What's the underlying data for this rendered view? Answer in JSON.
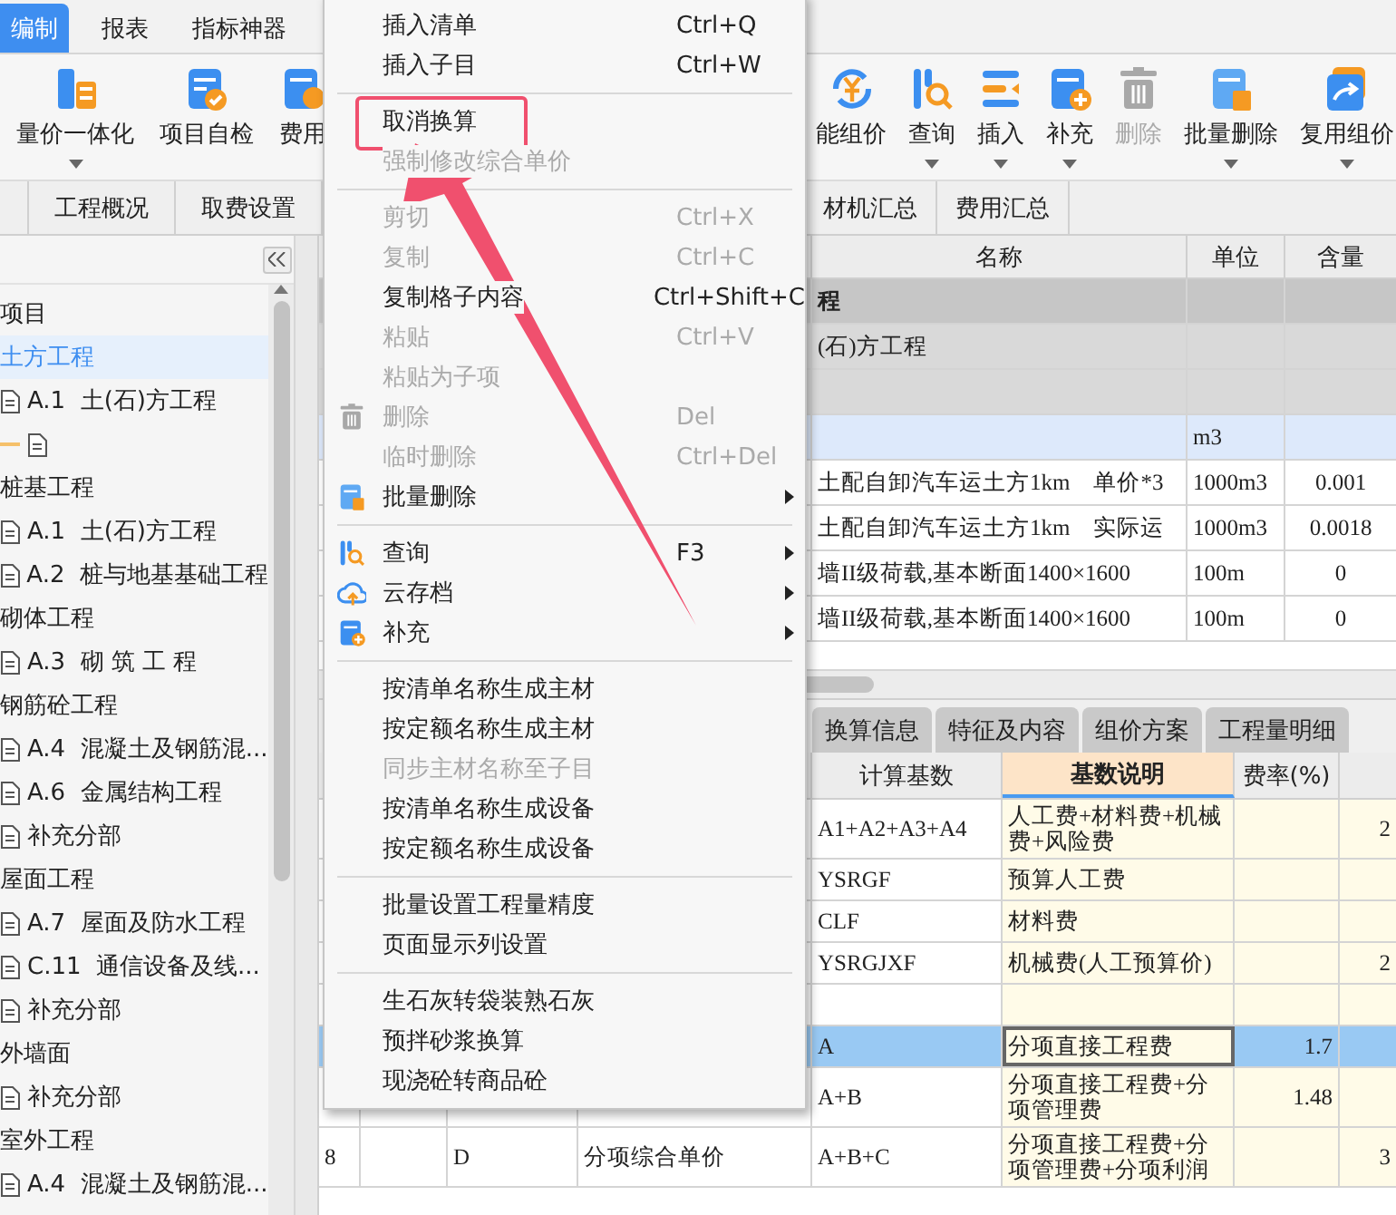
{
  "top_tabs": [
    {
      "label": "编制",
      "selected": true
    },
    {
      "label": "报表",
      "selected": false
    },
    {
      "label": "指标神器",
      "selected": false
    }
  ],
  "toolbar": {
    "left": [
      {
        "label": "量价一体化",
        "dropdown": true,
        "disabled": false
      },
      {
        "label": "项目自检",
        "dropdown": false,
        "disabled": false
      },
      {
        "label": "费用",
        "dropdown": false,
        "disabled": false
      }
    ],
    "right": [
      {
        "label": "能组价",
        "dropdown": false,
        "disabled": false
      },
      {
        "label": "查询",
        "dropdown": true,
        "disabled": false
      },
      {
        "label": "插入",
        "dropdown": true,
        "disabled": false
      },
      {
        "label": "补充",
        "dropdown": true,
        "disabled": false
      },
      {
        "label": "删除",
        "dropdown": false,
        "disabled": true
      },
      {
        "label": "批量删除",
        "dropdown": true,
        "disabled": false
      },
      {
        "label": "复用组价",
        "dropdown": true,
        "disabled": false
      }
    ]
  },
  "sub_tabs": {
    "left": [
      {
        "label": "工程概况",
        "selected": false
      },
      {
        "label": "取费设置",
        "selected": false
      }
    ],
    "right": [
      {
        "label": "材机汇总",
        "selected": false
      },
      {
        "label": "费用汇总",
        "selected": false
      }
    ]
  },
  "tree": [
    {
      "label": "项目",
      "selected": false
    },
    {
      "label": "土方工程",
      "selected": true,
      "children": [
        {
          "label": "A.1  土(石)方工程",
          "selected": false
        },
        {
          "kind": "blank",
          "selected": false
        }
      ]
    },
    {
      "label": "桩基工程",
      "selected": false,
      "children": [
        {
          "label": "A.1  土(石)方工程",
          "selected": false
        },
        {
          "label": "A.2  桩与地基基础工程",
          "selected": false
        }
      ]
    },
    {
      "label": "砌体工程",
      "selected": false,
      "children": [
        {
          "label": "A.3  砌 筑 工 程",
          "selected": false
        }
      ]
    },
    {
      "label": "钢筋砼工程",
      "selected": false,
      "children": [
        {
          "label": "A.4  混凝土及钢筋混...",
          "selected": false
        },
        {
          "label": "A.6  金属结构工程",
          "selected": false
        },
        {
          "label": "补充分部",
          "selected": false
        }
      ]
    },
    {
      "label": "屋面工程",
      "selected": false,
      "children": [
        {
          "label": "A.7  屋面及防水工程",
          "selected": false
        },
        {
          "label": "C.11  通信设备及线...",
          "selected": false
        },
        {
          "label": "补充分部",
          "selected": false
        }
      ]
    },
    {
      "label": "外墙面",
      "selected": false,
      "children": [
        {
          "label": "补充分部",
          "selected": false
        }
      ]
    },
    {
      "label": "室外工程",
      "selected": false,
      "children": [
        {
          "label": "A.4  混凝土及钢筋混...",
          "selected": false
        }
      ]
    }
  ],
  "upper_table": {
    "columns": [
      "名称",
      "单位",
      "含量"
    ],
    "rows": [
      {
        "kind": "section",
        "name": "程",
        "selected": false
      },
      {
        "kind": "subsection",
        "name": "(石)方工程",
        "selected": false
      },
      {
        "kind": "subsection",
        "selected": false
      },
      {
        "kind": "item",
        "unit": "m3",
        "selected": true
      },
      {
        "kind": "item",
        "name": "土配自卸汽车运土方1km　单价*3",
        "unit": "1000m3",
        "amount": "0.001",
        "selected": false
      },
      {
        "kind": "item",
        "name": "土配自卸汽车运土方1km　实际运",
        "unit": "1000m3",
        "amount": "0.0018",
        "selected": false
      },
      {
        "kind": "item",
        "name": "墙II级荷载,基本断面1400×1600",
        "unit": "100m",
        "amount": "0",
        "selected": false
      },
      {
        "kind": "item",
        "name": "墙II级荷载,基本断面1400×1600",
        "unit": "100m",
        "amount": "0",
        "selected": false
      }
    ]
  },
  "lower_tabs": [
    {
      "label": "换算信息",
      "selected": false
    },
    {
      "label": "特征及内容",
      "selected": false
    },
    {
      "label": "组价方案",
      "selected": false
    },
    {
      "label": "工程量明细",
      "selected": false
    }
  ],
  "lower_table": {
    "columns": [
      {
        "label": "计算基数",
        "selected": false
      },
      {
        "label": "基数说明",
        "selected": true
      },
      {
        "label": "费率(%)",
        "selected": false
      }
    ],
    "rows": [
      {
        "base": "A1+A2+A3+A4",
        "desc": "人工费+材料费+机械费+风险费",
        "column_8": "2",
        "selected": false
      },
      {
        "base": "YSRGF",
        "desc": "预算人工费",
        "selected": false
      },
      {
        "base": "CLF",
        "desc": "材料费",
        "selected": false
      },
      {
        "base": "YSRGJXF",
        "desc": "机械费(人工预算价)",
        "column_8": "2",
        "selected": false
      },
      {
        "selected": false
      },
      {
        "base": "A",
        "desc": "分项直接工程费",
        "rate": "1.7",
        "selected": true
      },
      {
        "base": "A+B",
        "desc": "分项直接工程费+分项管理费",
        "rate": "1.48",
        "selected": false
      },
      {
        "index": "8",
        "code": "D",
        "name": "分项综合单价",
        "base": "A+B+C",
        "desc": "分项直接工程费+分项管理费+分项利润",
        "column_8": "3",
        "selected": false
      }
    ]
  },
  "context_menu": [
    {
      "kind": "item",
      "label": "插入清单",
      "shortcut": "Ctrl+Q",
      "disabled": false
    },
    {
      "kind": "item",
      "label": "插入子目",
      "shortcut": "Ctrl+W",
      "disabled": false
    },
    {
      "kind": "separator"
    },
    {
      "kind": "item",
      "label": "取消换算",
      "disabled": false,
      "highlighted": true
    },
    {
      "kind": "item",
      "label": "强制修改综合单价",
      "disabled": true
    },
    {
      "kind": "separator"
    },
    {
      "kind": "item",
      "label": "剪切",
      "shortcut": "Ctrl+X",
      "disabled": true
    },
    {
      "kind": "item",
      "label": "复制",
      "shortcut": "Ctrl+C",
      "disabled": true
    },
    {
      "kind": "item",
      "label": "复制格子内容",
      "shortcut": "Ctrl+Shift+C",
      "disabled": false
    },
    {
      "kind": "item",
      "label": "粘贴",
      "shortcut": "Ctrl+V",
      "disabled": true
    },
    {
      "kind": "item",
      "label": "粘贴为子项",
      "disabled": true
    },
    {
      "kind": "item",
      "label": "删除",
      "shortcut": "Del",
      "disabled": true
    },
    {
      "kind": "item",
      "label": "临时删除",
      "shortcut": "Ctrl+Del",
      "disabled": true
    },
    {
      "kind": "item",
      "label": "批量删除",
      "disabled": false,
      "submenu": true
    },
    {
      "kind": "separator"
    },
    {
      "kind": "item",
      "label": "查询",
      "shortcut": "F3",
      "disabled": false,
      "submenu": true
    },
    {
      "kind": "item",
      "label": "云存档",
      "disabled": false,
      "submenu": true
    },
    {
      "kind": "item",
      "label": "补充",
      "disabled": false,
      "submenu": true
    },
    {
      "kind": "separator"
    },
    {
      "kind": "item",
      "label": "按清单名称生成主材",
      "disabled": false
    },
    {
      "kind": "item",
      "label": "按定额名称生成主材",
      "disabled": false
    },
    {
      "kind": "item",
      "label": "同步主材名称至子目",
      "disabled": true
    },
    {
      "kind": "item",
      "label": "按清单名称生成设备",
      "disabled": false
    },
    {
      "kind": "item",
      "label": "按定额名称生成设备",
      "disabled": false
    },
    {
      "kind": "separator"
    },
    {
      "kind": "item",
      "label": "批量设置工程量精度",
      "disabled": false
    },
    {
      "kind": "item",
      "label": "页面显示列设置",
      "disabled": false
    },
    {
      "kind": "separator"
    },
    {
      "kind": "item",
      "label": "生石灰转袋装熟石灰",
      "disabled": false
    },
    {
      "kind": "item",
      "label": "预拌砂浆换算",
      "disabled": false
    },
    {
      "kind": "item",
      "label": "现浇砼转商品砼",
      "disabled": false
    }
  ]
}
